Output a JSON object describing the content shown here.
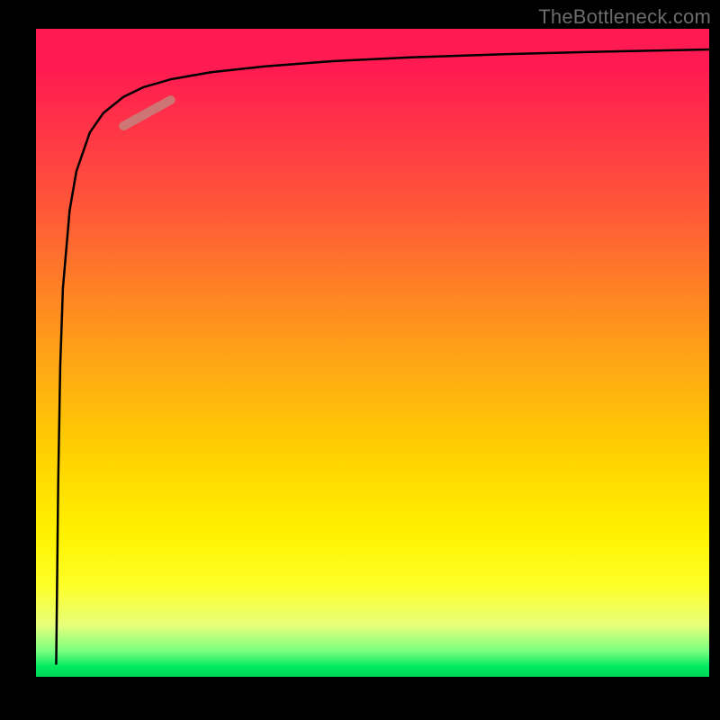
{
  "watermark": "TheBottleneck.com",
  "chart_data": {
    "type": "line",
    "title": "",
    "xlabel": "",
    "ylabel": "",
    "xlim": [
      0,
      100
    ],
    "ylim": [
      0,
      100
    ],
    "grid": false,
    "legend": false,
    "background_gradient": {
      "top": "#ff1a52",
      "middle": "#ffd200",
      "bottom": "#00d858"
    },
    "series": [
      {
        "name": "curve",
        "x": [
          3.0,
          3.3,
          3.6,
          4.0,
          5.0,
          6.0,
          8.0,
          10.0,
          13.0,
          16.0,
          20.0,
          26.0,
          34.0,
          44.0,
          56.0,
          70.0,
          85.0,
          100.0
        ],
        "y": [
          2.0,
          30.0,
          48.0,
          60.0,
          72.0,
          78.0,
          84.0,
          87.0,
          89.5,
          91.0,
          92.2,
          93.3,
          94.2,
          95.0,
          95.6,
          96.1,
          96.5,
          96.8
        ]
      }
    ],
    "marker_segment": {
      "x": [
        13.0,
        20.0
      ],
      "y": [
        85.0,
        89.0
      ]
    }
  }
}
